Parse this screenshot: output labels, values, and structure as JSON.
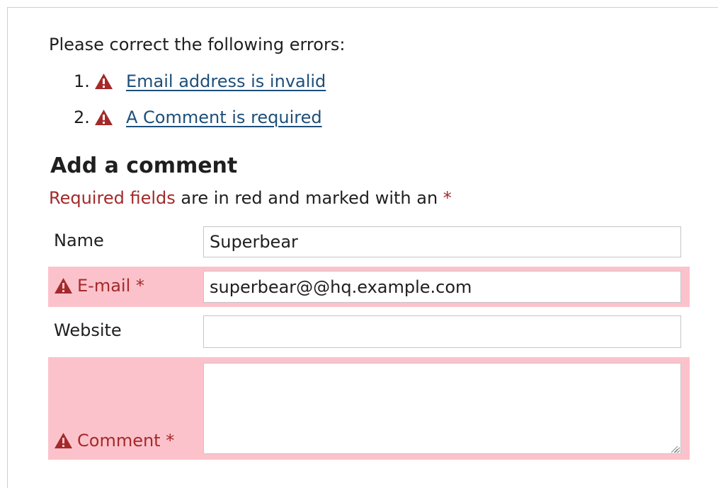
{
  "errors": {
    "intro": "Please correct the following errors:",
    "items": [
      {
        "number": "1.",
        "text": "Email address is invalid"
      },
      {
        "number": "2.",
        "text": "A Comment is required"
      }
    ]
  },
  "form": {
    "title": "Add a comment",
    "required_note": {
      "highlight": "Required fields",
      "rest": " are in red and marked with an ",
      "asterisk": "*"
    },
    "fields": {
      "name": {
        "label": "Name",
        "value": "Superbear"
      },
      "email": {
        "label": "E-mail *",
        "value": "superbear@@hq.example.com"
      },
      "website": {
        "label": "Website",
        "value": ""
      },
      "comment": {
        "label": "Comment *",
        "value": ""
      }
    }
  },
  "colors": {
    "error_text": "#a32a2a",
    "error_background": "#fcc2cb",
    "link": "#1d4f7a"
  },
  "icons": {
    "warning": "warning-triangle-icon"
  }
}
